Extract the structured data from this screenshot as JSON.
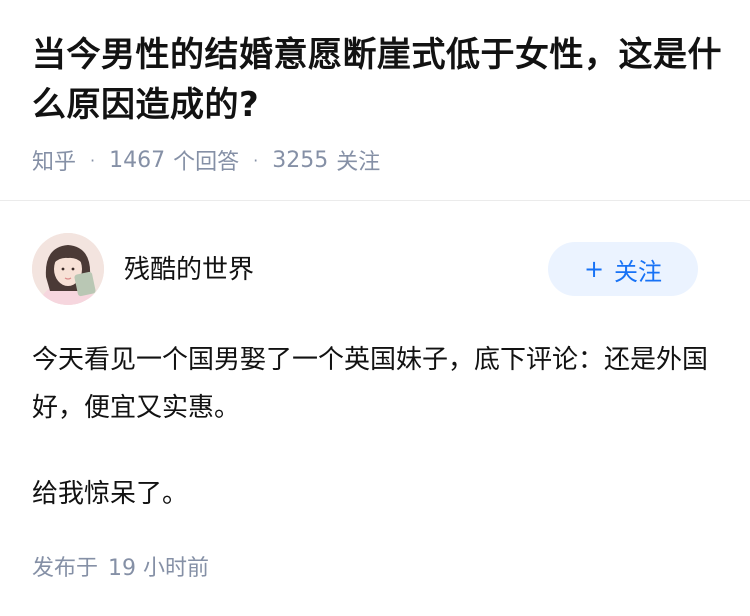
{
  "question": {
    "title": "当今男性的结婚意愿断崖式低于女性，这是什么原因造成的?"
  },
  "meta": {
    "source": "知乎",
    "answers_count": "1467",
    "answers_label": "个回答",
    "followers_count": "3255",
    "followers_label": "关注"
  },
  "author": {
    "name": "残酷的世界",
    "avatar_icon": "avatar-image",
    "follow_label": "关注",
    "follow_icon": "plus-icon"
  },
  "answer": {
    "paragraphs": [
      "今天看见一个国男娶了一个英国妹子，底下评论：还是外国好，便宜又实惠。",
      "给我惊呆了。"
    ]
  },
  "footer": {
    "published_label": "发布于",
    "published_value": "19 小时前"
  },
  "colors": {
    "text": "#121212",
    "meta": "#8590a6",
    "accent": "#1772f6",
    "follow_bg": "#ebf3ff"
  }
}
